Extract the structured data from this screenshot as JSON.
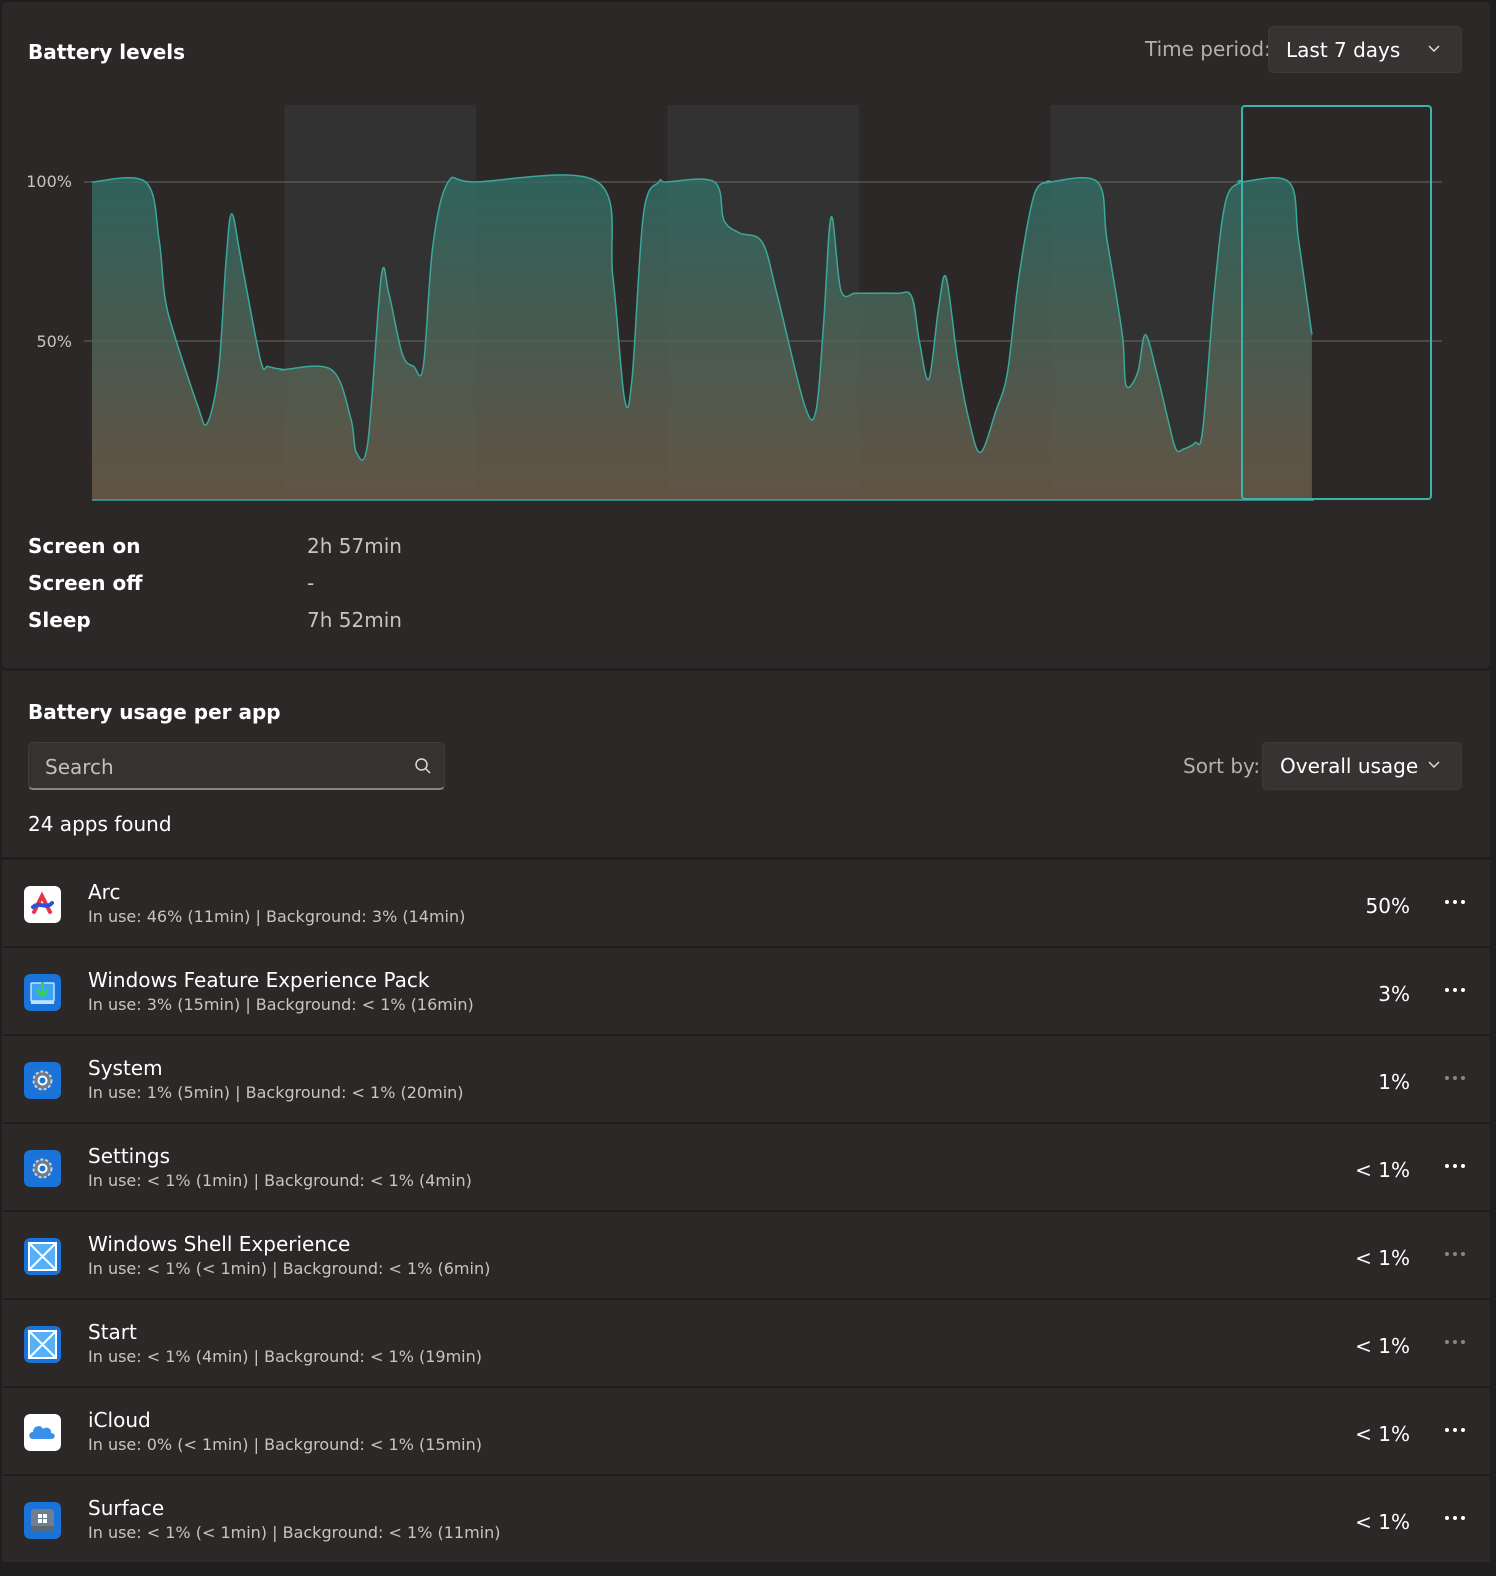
{
  "battery_levels": {
    "title": "Battery levels",
    "time_period_label": "Time period:",
    "time_period_value": "Last 7 days",
    "y_ticks": [
      "100%",
      "50%"
    ],
    "colors": {
      "line": "#3aa89a",
      "fill_top": "#2f6b63",
      "fill_bottom": "#6b5a48",
      "selected_border": "#3ab5a8"
    }
  },
  "chart_data": {
    "type": "area",
    "title": "Battery levels",
    "ylabel": "",
    "ylim": [
      0,
      100
    ],
    "y_ticks": [
      "100%",
      "50%"
    ],
    "days": 7,
    "selected_day_index": 6,
    "series": [
      {
        "values_by_day_fraction": [
          [
            0.0,
            100
          ],
          [
            0.28,
            100
          ],
          [
            0.35,
            82
          ],
          [
            0.38,
            64
          ],
          [
            0.43,
            52
          ],
          [
            0.55,
            30
          ],
          [
            0.6,
            24
          ],
          [
            0.66,
            40
          ],
          [
            0.7,
            75
          ],
          [
            0.73,
            90
          ],
          [
            0.78,
            75
          ],
          [
            0.88,
            44
          ],
          [
            0.92,
            42
          ],
          [
            1.0,
            41
          ],
          [
            1.0,
            41
          ],
          [
            1.25,
            41
          ],
          [
            1.35,
            26
          ],
          [
            1.38,
            15
          ],
          [
            1.44,
            18
          ],
          [
            1.51,
            70
          ],
          [
            1.55,
            65
          ],
          [
            1.62,
            46
          ],
          [
            1.68,
            42
          ],
          [
            1.73,
            42
          ],
          [
            1.78,
            80
          ],
          [
            1.86,
            100
          ],
          [
            2.0,
            100
          ],
          [
            2.64,
            100
          ],
          [
            2.72,
            70
          ],
          [
            2.78,
            32
          ],
          [
            2.82,
            38
          ],
          [
            2.88,
            90
          ],
          [
            2.96,
            100
          ],
          [
            3.0,
            100
          ],
          [
            3.25,
            100
          ],
          [
            3.3,
            88
          ],
          [
            3.38,
            84
          ],
          [
            3.5,
            81
          ],
          [
            3.58,
            64
          ],
          [
            3.72,
            30
          ],
          [
            3.78,
            28
          ],
          [
            3.82,
            55
          ],
          [
            3.86,
            89
          ],
          [
            3.91,
            66
          ],
          [
            3.98,
            65
          ],
          [
            4.0,
            65
          ],
          [
            4.2,
            65
          ],
          [
            4.28,
            64
          ],
          [
            4.32,
            50
          ],
          [
            4.37,
            38
          ],
          [
            4.42,
            60
          ],
          [
            4.46,
            70
          ],
          [
            4.52,
            44
          ],
          [
            4.58,
            25
          ],
          [
            4.64,
            15
          ],
          [
            4.72,
            28
          ],
          [
            4.78,
            40
          ],
          [
            4.84,
            70
          ],
          [
            4.92,
            96
          ],
          [
            5.0,
            100
          ],
          [
            5.0,
            100
          ],
          [
            5.25,
            100
          ],
          [
            5.3,
            82
          ],
          [
            5.38,
            52
          ],
          [
            5.4,
            36
          ],
          [
            5.46,
            40
          ],
          [
            5.5,
            52
          ],
          [
            5.56,
            40
          ],
          [
            5.62,
            25
          ],
          [
            5.66,
            16
          ],
          [
            5.7,
            16
          ],
          [
            5.76,
            18
          ],
          [
            5.8,
            22
          ],
          [
            5.86,
            65
          ],
          [
            5.92,
            94
          ],
          [
            6.0,
            100
          ],
          [
            6.0,
            100
          ],
          [
            6.25,
            100
          ],
          [
            6.3,
            82
          ],
          [
            6.37,
            52
          ]
        ]
      }
    ]
  },
  "stats": [
    {
      "label": "Screen on",
      "value": "2h 57min"
    },
    {
      "label": "Screen off",
      "value": "-"
    },
    {
      "label": "Sleep",
      "value": "7h 52min"
    }
  ],
  "usage": {
    "title": "Battery usage per app",
    "search_placeholder": "Search",
    "sort_label": "Sort by:",
    "sort_value": "Overall usage",
    "apps_found": "24 apps found"
  },
  "apps": [
    {
      "name": "Arc",
      "detail": "In use: 46% (11min) | Background: 3% (14min)",
      "pct": "50%",
      "icon": "arc-icon"
    },
    {
      "name": "Windows Feature Experience Pack",
      "detail": "In use: 3% (15min) | Background: < 1% (16min)",
      "pct": "3%",
      "icon": "feature-pack-icon"
    },
    {
      "name": "System",
      "detail": "In use: 1% (5min) | Background: < 1% (20min)",
      "pct": "1%",
      "icon": "gear-icon"
    },
    {
      "name": "Settings",
      "detail": "In use: < 1% (1min) | Background: < 1% (4min)",
      "pct": "< 1%",
      "icon": "gear-icon"
    },
    {
      "name": "Windows Shell Experience",
      "detail": "In use: < 1% (< 1min) | Background: < 1% (6min)",
      "pct": "< 1%",
      "icon": "placeholder-app-icon"
    },
    {
      "name": "Start",
      "detail": "In use: < 1% (4min) | Background: < 1% (19min)",
      "pct": "< 1%",
      "icon": "placeholder-app-icon"
    },
    {
      "name": "iCloud",
      "detail": "In use: 0% (< 1min) | Background: < 1% (15min)",
      "pct": "< 1%",
      "icon": "cloud-icon"
    },
    {
      "name": "Surface",
      "detail": "In use: < 1% (< 1min) | Background: < 1% (11min)",
      "pct": "< 1%",
      "icon": "surface-icon"
    }
  ]
}
